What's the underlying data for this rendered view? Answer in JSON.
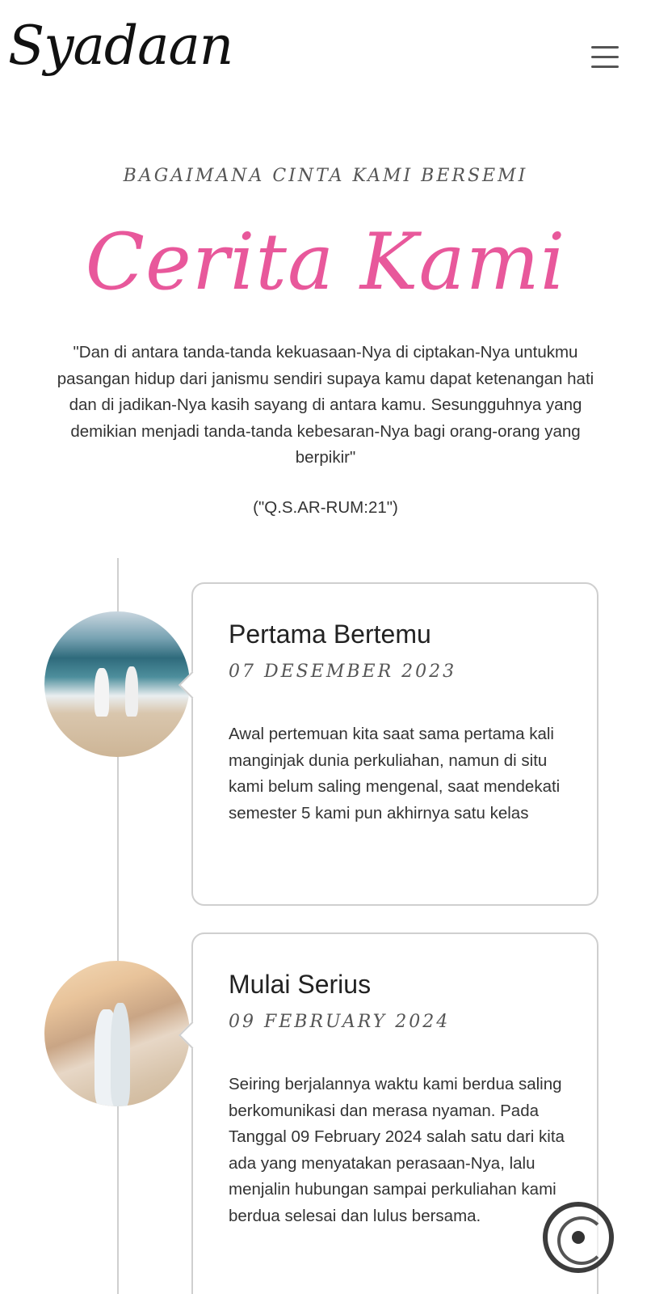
{
  "header": {
    "logo_text": "Syadaan",
    "menu_icon": "hamburger-menu-icon"
  },
  "section": {
    "subtitle": "BAGAIMANA CINTA KAMI BERSEMI",
    "title": "Cerita Kami",
    "quote": "\"Dan di antara tanda-tanda kekuasaan-Nya di ciptakan-Nya untukmu pasangan hidup dari janismu sendiri supaya kamu dapat ketenangan hati dan di jadikan-Nya kasih sayang di antara kamu. Sesungguhnya yang demikian menjadi tanda-tanda kebesaran-Nya bagi orang-orang yang berpikir\"",
    "source": "(\"Q.S.AR-RUM:21\")"
  },
  "colors": {
    "accent": "#e8589b",
    "border": "#cfcfcf"
  },
  "timeline": [
    {
      "title": "Pertama Bertemu",
      "date": "07 DESEMBER 2023",
      "text": "Awal pertemuan kita saat sama pertama kali manginjak dunia perkuliahan, namun di situ kami belum saling mengenal, saat mendekati semester 5 kami pun akhirnya satu kelas"
    },
    {
      "title": "Mulai Serius",
      "date": "09 FEBRUARY 2024",
      "text": "Seiring berjalannya waktu kami berdua saling berkomunikasi dan merasa nyaman. Pada Tanggal 09 February 2024 salah satu dari kita ada yang menyatakan perasaan-Nya, lalu menjalin hubungan sampai perkuliahan kami berdua selesai dan lulus bersama."
    }
  ],
  "music_button_icon": "music-disc-icon"
}
